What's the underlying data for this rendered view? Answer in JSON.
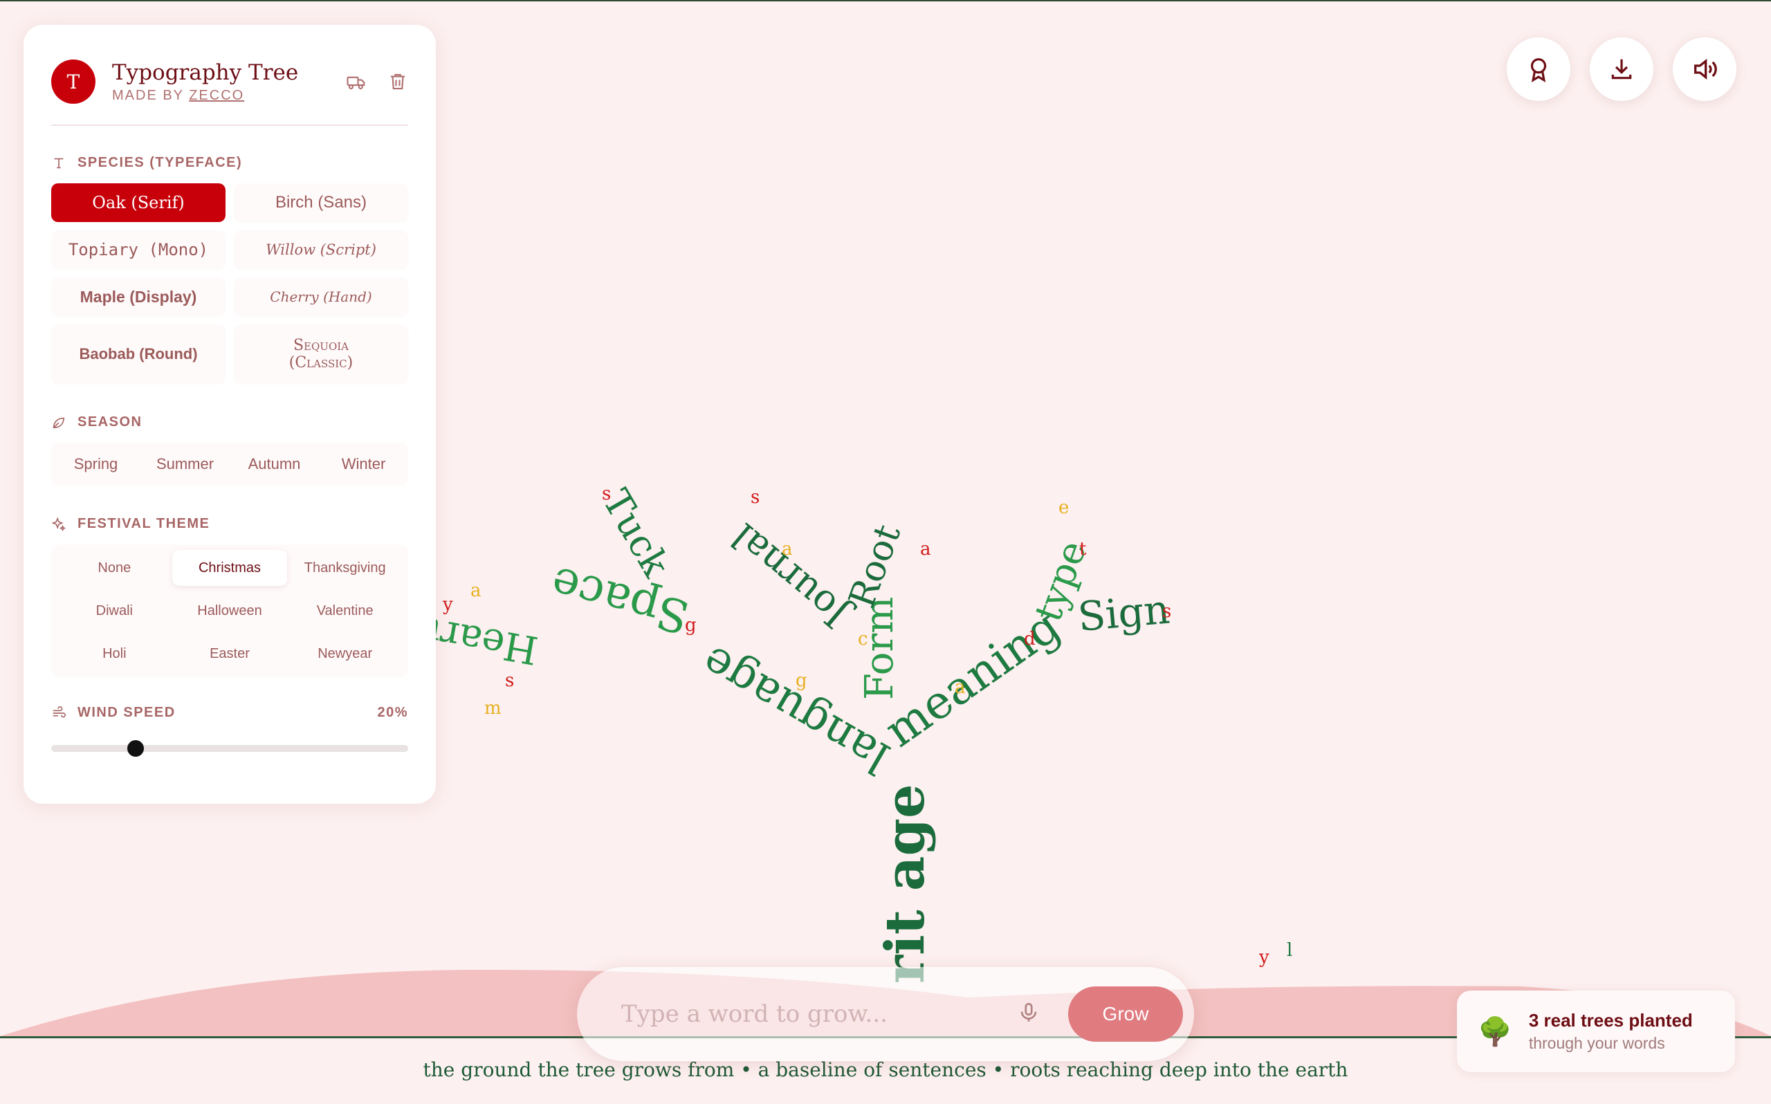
{
  "app": {
    "title": "Typography Tree",
    "made_by_prefix": "MADE BY ",
    "made_by_name": "ZECCO",
    "logo_letter": "T"
  },
  "species": {
    "label": "SPECIES (TYPEFACE)",
    "options": [
      "Oak (Serif)",
      "Birch (Sans)",
      "Topiary (Mono)",
      "Willow (Script)",
      "Maple (Display)",
      "Cherry (Hand)",
      "Baobab (Round)",
      "Sequoia (Classic)"
    ],
    "selected": "Oak (Serif)"
  },
  "season": {
    "label": "SEASON",
    "options": [
      "Spring",
      "Summer",
      "Autumn",
      "Winter"
    ]
  },
  "festival": {
    "label": "FESTIVAL THEME",
    "options": [
      "None",
      "Christmas",
      "Thanksgiving",
      "Diwali",
      "Halloween",
      "Valentine",
      "Holi",
      "Easter",
      "Newyear"
    ],
    "selected": "Christmas"
  },
  "wind": {
    "label": "WIND SPEED",
    "value_text": "20%",
    "value": 0.2
  },
  "input": {
    "placeholder": "Type a word to grow...",
    "grow_label": "Grow"
  },
  "planted": {
    "emoji": "🌳",
    "headline": "3 real trees planted",
    "subline": "through your words"
  },
  "ground_text": "the ground the tree grows from • a baseline of sentences • roots reaching deep into the earth",
  "tree_words": {
    "trunk": "rit age",
    "branches": [
      "language",
      "Space",
      "Heart",
      "Tuck",
      "Journal",
      "meaning",
      "type",
      "Sign",
      "Form",
      "Root"
    ]
  },
  "colors": {
    "accent": "#c8000a",
    "green_dark": "#1b6b3c",
    "green_light": "#2a9a4a",
    "gold": "#e8b020",
    "red": "#d11a1a"
  }
}
